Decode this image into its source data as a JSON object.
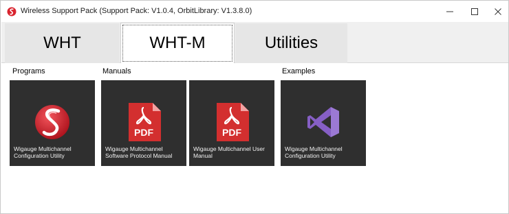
{
  "window": {
    "title": "Wireless Support Pack (Support Pack: V1.0.4, OrbitLibrary: V1.3.8.0)"
  },
  "tabs": [
    {
      "label": "WHT",
      "selected": false
    },
    {
      "label": "WHT-M",
      "selected": true
    },
    {
      "label": "Utilities",
      "selected": false
    }
  ],
  "sections": {
    "programs": "Programs",
    "manuals": "Manuals",
    "examples": "Examples"
  },
  "tiles": [
    {
      "label": "Wigauge Multichannel Configuration Utility",
      "icon": "wigauge-logo-icon"
    },
    {
      "label": "Wigauge Multichannel Software Protocol Manual",
      "icon": "pdf-icon"
    },
    {
      "label": "Wigauge Multichannel User Manual",
      "icon": "pdf-icon"
    },
    {
      "label": "Wigauge Multichannel Configuration Utility",
      "icon": "visual-studio-icon"
    }
  ],
  "icons": {
    "pdf_badge": "PDF"
  },
  "colors": {
    "tile_background": "#2f2f2f",
    "pdf_red": "#d32f2f",
    "logo_red": "#d9232e",
    "vs_purple": "#865fc5"
  }
}
